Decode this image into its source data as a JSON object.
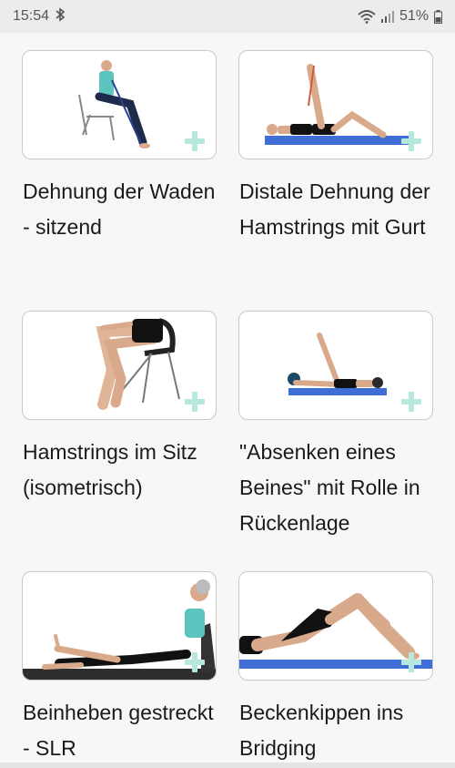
{
  "status_bar": {
    "time": "15:54",
    "battery": "51%"
  },
  "exercises": [
    {
      "title": "Dehnung der Waden - sitzend"
    },
    {
      "title": "Distale Dehnung der Hamstrings mit Gurt"
    },
    {
      "title": "Hamstrings im Sitz (isometrisch)"
    },
    {
      "title": "\"Absenken eines Beines\" mit Rolle in Rückenlage"
    },
    {
      "title": "Beinheben gestreckt - SLR"
    },
    {
      "title": "Beckenkippen ins Bridging"
    }
  ],
  "colors": {
    "accent_plus": "#b6e8de",
    "mat": "#3f6fd6",
    "shirt": "#5cc5c0"
  },
  "icons": [
    "bluetooth-icon",
    "wifi-icon",
    "signal-icon",
    "battery-icon",
    "add-icon"
  ]
}
